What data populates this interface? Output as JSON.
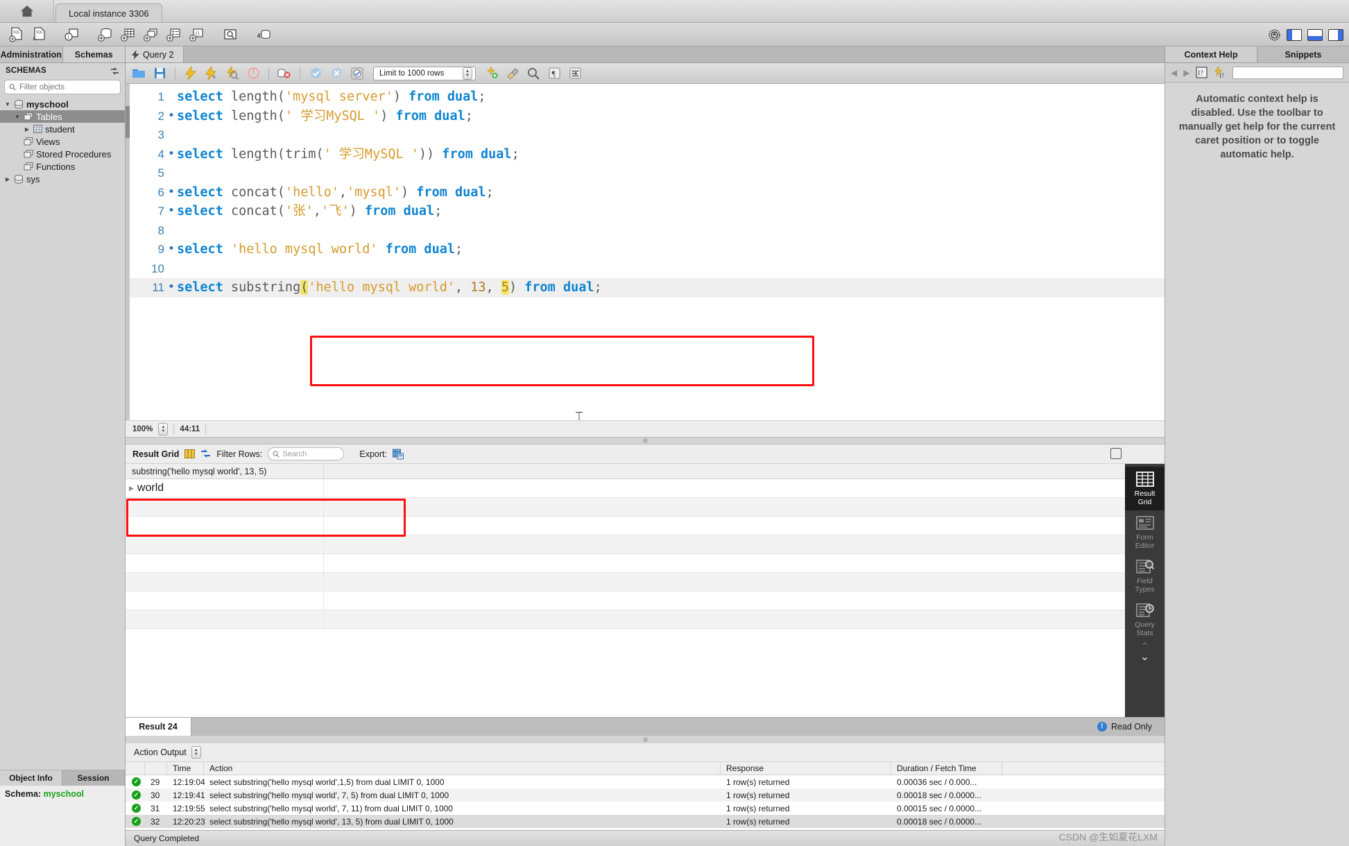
{
  "window": {
    "home_label": "home-icon",
    "instance_tab": "Local instance 3306",
    "main_toolbar_icons": [
      "new-sql-file-icon",
      "open-sql-file-icon",
      "sql-info-icon",
      "new-schema-icon",
      "new-table-icon",
      "new-view-icon",
      "new-procedure-icon",
      "new-function-icon",
      "inspect-table-icon",
      "search-data-icon"
    ],
    "right_icons": [
      "gear-icon",
      "toggle-left-panel-icon",
      "toggle-bottom-panel-icon",
      "toggle-right-panel-icon"
    ]
  },
  "tabs": {
    "administration": "Administration",
    "schemas": "Schemas",
    "query": "Query 2",
    "query_icon": "lightning-icon"
  },
  "sidebar": {
    "header": "SCHEMAS",
    "refresh_icon": "refresh-icon",
    "filter_placeholder": "Filter objects",
    "search_icon": "search-icon",
    "tree": [
      {
        "label": "myschool",
        "icon": "schema-icon",
        "arrow": "▼",
        "indent": 0,
        "bold": true,
        "selected": false
      },
      {
        "label": "Tables",
        "icon": "folder-icon",
        "arrow": "▼",
        "indent": 1,
        "bold": false,
        "selected": true
      },
      {
        "label": "student",
        "icon": "table-icon",
        "arrow": "▶",
        "indent": 2,
        "bold": false,
        "selected": false
      },
      {
        "label": "Views",
        "icon": "folder-icon",
        "arrow": "",
        "indent": 1,
        "bold": false,
        "selected": false
      },
      {
        "label": "Stored Procedures",
        "icon": "folder-icon",
        "arrow": "",
        "indent": 1,
        "bold": false,
        "selected": false
      },
      {
        "label": "Functions",
        "icon": "folder-icon",
        "arrow": "",
        "indent": 1,
        "bold": false,
        "selected": false
      },
      {
        "label": "sys",
        "icon": "schema-icon",
        "arrow": "▶",
        "indent": 0,
        "bold": false,
        "selected": false
      }
    ],
    "bottom_tabs": {
      "object_info": "Object Info",
      "session": "Session"
    },
    "schema_label": "Schema:",
    "schema_value": "myschool"
  },
  "query_toolbar": {
    "icons": [
      "open-file-icon",
      "save-file-icon",
      "execute-icon",
      "execute-current-icon",
      "explain-icon",
      "stop-icon",
      "toggle-statement-icon",
      "commit-icon",
      "rollback-icon",
      "autocommit-icon"
    ],
    "limit_value": "Limit to 1000 rows",
    "right_icons": [
      "beautify-icon",
      "clean-icon",
      "find-icon",
      "invisible-chars-icon",
      "wrap-lines-icon"
    ]
  },
  "editor": {
    "lines": [
      {
        "num": "1",
        "bullet": false,
        "tokens": [
          {
            "t": "select",
            "c": "kw"
          },
          {
            "t": " length",
            "c": "fn"
          },
          {
            "t": "(",
            "c": "pun"
          },
          {
            "t": "'mysql server'",
            "c": "str"
          },
          {
            "t": ")",
            "c": "pun"
          },
          {
            "t": " from",
            "c": "kw"
          },
          {
            "t": " dual",
            "c": "kw"
          },
          {
            "t": ";",
            "c": "pun"
          }
        ]
      },
      {
        "num": "2",
        "bullet": true,
        "tokens": [
          {
            "t": "select",
            "c": "kw"
          },
          {
            "t": " length",
            "c": "fn"
          },
          {
            "t": "(",
            "c": "pun"
          },
          {
            "t": "' 学习MySQL '",
            "c": "str"
          },
          {
            "t": ")",
            "c": "pun"
          },
          {
            "t": " from",
            "c": "kw"
          },
          {
            "t": " dual",
            "c": "kw"
          },
          {
            "t": ";",
            "c": "pun"
          }
        ]
      },
      {
        "num": "3",
        "bullet": false,
        "tokens": []
      },
      {
        "num": "4",
        "bullet": true,
        "tokens": [
          {
            "t": "select",
            "c": "kw"
          },
          {
            "t": " length",
            "c": "fn"
          },
          {
            "t": "(",
            "c": "pun"
          },
          {
            "t": "trim",
            "c": "fn"
          },
          {
            "t": "(",
            "c": "pun"
          },
          {
            "t": "' 学习MySQL '",
            "c": "str"
          },
          {
            "t": "))",
            "c": "pun"
          },
          {
            "t": " from",
            "c": "kw"
          },
          {
            "t": " dual",
            "c": "kw"
          },
          {
            "t": ";",
            "c": "pun"
          }
        ]
      },
      {
        "num": "5",
        "bullet": false,
        "tokens": []
      },
      {
        "num": "6",
        "bullet": true,
        "tokens": [
          {
            "t": "select",
            "c": "kw"
          },
          {
            "t": " concat",
            "c": "fn"
          },
          {
            "t": "(",
            "c": "pun"
          },
          {
            "t": "'hello'",
            "c": "str"
          },
          {
            "t": ",",
            "c": "pun"
          },
          {
            "t": "'mysql'",
            "c": "str"
          },
          {
            "t": ")",
            "c": "pun"
          },
          {
            "t": " from",
            "c": "kw"
          },
          {
            "t": " dual",
            "c": "kw"
          },
          {
            "t": ";",
            "c": "pun"
          }
        ]
      },
      {
        "num": "7",
        "bullet": true,
        "tokens": [
          {
            "t": "select",
            "c": "kw"
          },
          {
            "t": " concat",
            "c": "fn"
          },
          {
            "t": "(",
            "c": "pun"
          },
          {
            "t": "'张'",
            "c": "str"
          },
          {
            "t": ",",
            "c": "pun"
          },
          {
            "t": "'飞'",
            "c": "str"
          },
          {
            "t": ")",
            "c": "pun"
          },
          {
            "t": " from",
            "c": "kw"
          },
          {
            "t": " dual",
            "c": "kw"
          },
          {
            "t": ";",
            "c": "pun"
          }
        ]
      },
      {
        "num": "8",
        "bullet": false,
        "tokens": []
      },
      {
        "num": "9",
        "bullet": true,
        "tokens": [
          {
            "t": "select",
            "c": "kw"
          },
          {
            "t": " 'hello mysql world'",
            "c": "str"
          },
          {
            "t": " from",
            "c": "kw"
          },
          {
            "t": " dual",
            "c": "kw"
          },
          {
            "t": ";",
            "c": "pun"
          }
        ]
      },
      {
        "num": "10",
        "bullet": false,
        "tokens": []
      },
      {
        "num": "11",
        "bullet": true,
        "current": true,
        "tokens": [
          {
            "t": "select",
            "c": "kw"
          },
          {
            "t": " substring",
            "c": "fn"
          },
          {
            "t": "(",
            "c": "pun hl"
          },
          {
            "t": "'hello mysql world'",
            "c": "str"
          },
          {
            "t": ", ",
            "c": "pun"
          },
          {
            "t": "13",
            "c": "num"
          },
          {
            "t": ", ",
            "c": "pun"
          },
          {
            "t": "5",
            "c": "num hl"
          },
          {
            "t": ")",
            "c": "pun"
          },
          {
            "t": " from",
            "c": "kw"
          },
          {
            "t": " dual",
            "c": "kw"
          },
          {
            "t": ";",
            "c": "pun"
          }
        ]
      }
    ],
    "zoom": "100%",
    "caret_position": "44:11",
    "text_caret_icon": "i-beam-cursor"
  },
  "result_grid": {
    "title": "Result Grid",
    "grid_icon": "grid-icon",
    "wrap_icon": "wrap-cell-icon",
    "filter_label": "Filter Rows:",
    "filter_placeholder": "Search",
    "search_icon": "search-icon",
    "export_label": "Export:",
    "export_icon": "export-icon",
    "fullscreen_icon": "maximize-grid-icon",
    "columns": [
      "substring('hello mysql world', 13, 5)"
    ],
    "rows": [
      [
        "world"
      ]
    ],
    "empty_rows": 7,
    "side_items": [
      {
        "label": "Result\nGrid",
        "icon": "result-grid-icon",
        "active": true
      },
      {
        "label": "Form\nEditor",
        "icon": "form-editor-icon",
        "active": false
      },
      {
        "label": "Field\nTypes",
        "icon": "field-types-icon",
        "active": false
      },
      {
        "label": "Query\nStats",
        "icon": "query-stats-icon",
        "active": false
      }
    ],
    "scroll_up_icon": "chevron-up-icon",
    "scroll_down_icon": "chevron-down-icon",
    "result_tab": "Result 24",
    "read_only": "Read Only",
    "read_only_icon": "info-icon"
  },
  "action_output": {
    "selector_label": "Action Output",
    "columns": [
      "",
      "",
      "Time",
      "Action",
      "Response",
      "Duration / Fetch Time"
    ],
    "rows": [
      {
        "status": "ok",
        "num": "29",
        "time": "12:19:04",
        "action": "select substring('hello mysql world',1,5) from dual LIMIT 0, 1000",
        "response": "1 row(s) returned",
        "duration": "0.00036 sec / 0.000..."
      },
      {
        "status": "ok",
        "num": "30",
        "time": "12:19:41",
        "action": "select substring('hello mysql world', 7, 5) from dual LIMIT 0, 1000",
        "response": "1 row(s) returned",
        "duration": "0.00018 sec / 0.0000..."
      },
      {
        "status": "ok",
        "num": "31",
        "time": "12:19:55",
        "action": "select substring('hello mysql world', 7, 11) from dual LIMIT 0, 1000",
        "response": "1 row(s) returned",
        "duration": "0.00015 sec / 0.0000..."
      },
      {
        "status": "ok",
        "num": "32",
        "time": "12:20:23",
        "action": "select substring('hello mysql world', 13, 5) from dual LIMIT 0, 1000",
        "response": "1 row(s) returned",
        "duration": "0.00018 sec / 0.0000..."
      }
    ]
  },
  "footer": {
    "status": "Query Completed",
    "watermark": "CSDN @生如夏花LXM"
  },
  "context_help": {
    "tab_context_help": "Context Help",
    "tab_snippets": "Snippets",
    "back_icon": "arrow-left-icon",
    "forward_icon": "arrow-right-icon",
    "help-index_icon": "help-index-icon",
    "auto-help_icon": "auto-help-icon",
    "message": "Automatic context help is disabled. Use the toolbar to manually get help for the current caret position or to toggle automatic help."
  },
  "colors": {
    "highlight_box": "#fd0d0d",
    "keyword": "#0d84d1",
    "string": "#d69a2e",
    "token_highlight": "#f5e46a",
    "schema_green": "#19a319",
    "accent_blue": "#3b6ee0"
  }
}
